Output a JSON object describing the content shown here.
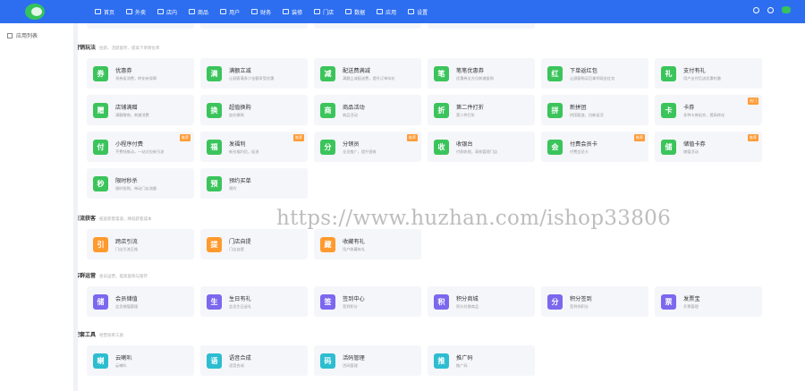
{
  "header": {
    "nav": [
      {
        "label": "首页"
      },
      {
        "label": "外卖"
      },
      {
        "label": "店内"
      },
      {
        "label": "商品"
      },
      {
        "label": "用户"
      },
      {
        "label": "财务"
      },
      {
        "label": "装修"
      },
      {
        "label": "门店"
      },
      {
        "label": "数据"
      },
      {
        "label": "应用"
      },
      {
        "label": "设置"
      }
    ]
  },
  "sidebar": {
    "item": "应用列表"
  },
  "sections": [
    {
      "title": "营销玩法",
      "subtitle": "拉新、活跃留存、提高下单转化率",
      "cards": [
        {
          "name": "优惠券",
          "desc": "领券促消费，转化有保障",
          "icon": "券",
          "color": "#3bc45b"
        },
        {
          "name": "满额立减",
          "desc": "让顾客满多少金额享受优惠",
          "icon": "满",
          "color": "#3bc45b"
        },
        {
          "name": "配送费满减",
          "desc": "满额立减配送费，提升订单均价",
          "icon": "减",
          "color": "#3bc45b"
        },
        {
          "name": "笔笔优惠券",
          "desc": "优惠券全方位刺激复购",
          "icon": "笔",
          "color": "#3bc45b"
        },
        {
          "name": "下单返红包",
          "desc": "让顾客购买后拿到现金红包",
          "icon": "红",
          "color": "#3bc45b"
        },
        {
          "name": "支付有礼",
          "desc": "用户支付后送优惠刺激",
          "icon": "礼",
          "color": "#3bc45b"
        },
        {
          "name": "店铺满赠",
          "desc": "满额赠商，刺激消费",
          "icon": "赠",
          "color": "#3bc45b"
        },
        {
          "name": "超值换购",
          "desc": "加价换购",
          "icon": "换",
          "color": "#3bc45b"
        },
        {
          "name": "商品活动",
          "desc": "商品活动",
          "icon": "商",
          "color": "#3bc45b"
        },
        {
          "name": "第二件打折",
          "desc": "第二件打折",
          "icon": "折",
          "color": "#3bc45b"
        },
        {
          "name": "新拼团",
          "desc": "拼团裂变，拉新促活",
          "icon": "拼",
          "color": "#3bc45b"
        },
        {
          "name": "卡券",
          "desc": "多种卡券组合，提高转化",
          "icon": "卡",
          "color": "#3bc45b",
          "badge": "热门"
        },
        {
          "name": "小程序付费",
          "desc": "不费钱推动，一站式拉新引流",
          "icon": "付",
          "color": "#3bc45b",
          "badge": "推荐"
        },
        {
          "name": "发福利",
          "desc": "新拉福利员，促进",
          "icon": "福",
          "color": "#3bc45b",
          "badge": "推荐"
        },
        {
          "name": "分销员",
          "desc": "全员推广，提升营收",
          "icon": "分",
          "color": "#3bc45b",
          "badge": "推荐"
        },
        {
          "name": "收银台",
          "desc": "付款收银，高效管理门店",
          "icon": "收",
          "color": "#3bc45b"
        },
        {
          "name": "付费会员卡",
          "desc": "付费会员卡",
          "icon": "会",
          "color": "#3bc45b",
          "badge": "推荐"
        },
        {
          "name": "储值卡券",
          "desc": "储值活动",
          "icon": "储",
          "color": "#3bc45b",
          "badge": "推荐"
        },
        {
          "name": "限时秒杀",
          "desc": "限时抢购，带动门店流量",
          "icon": "秒",
          "color": "#3bc45b"
        },
        {
          "name": "预约买单",
          "desc": "预约",
          "icon": "预",
          "color": "#3bc45b"
        }
      ]
    },
    {
      "title": "引流获客",
      "subtitle": "拓宽获客渠道，降低获客成本",
      "cards": [
        {
          "name": "跨店引流",
          "desc": "门店引流互推",
          "icon": "引",
          "color": "#ff9a2e"
        },
        {
          "name": "门店自提",
          "desc": "门店自提",
          "icon": "提",
          "color": "#ff9a2e"
        },
        {
          "name": "收藏有礼",
          "desc": "用户收藏有礼",
          "icon": "藏",
          "color": "#ff9a2e"
        }
      ]
    },
    {
      "title": "客群运营",
      "subtitle": "会员运营，提高复购与留存",
      "cards": [
        {
          "name": "会员储值",
          "desc": "会员储值管理",
          "icon": "储",
          "color": "#7b68ee"
        },
        {
          "name": "生日有礼",
          "desc": "会员生日送礼",
          "icon": "生",
          "color": "#7b68ee"
        },
        {
          "name": "签到中心",
          "desc": "签到积分",
          "icon": "签",
          "color": "#7b68ee"
        },
        {
          "name": "积分商城",
          "desc": "积分兑换商品",
          "icon": "积",
          "color": "#7b68ee"
        },
        {
          "name": "积分签到",
          "desc": "签到领积分",
          "icon": "分",
          "color": "#7b68ee"
        },
        {
          "name": "发票宝",
          "desc": "开票管理",
          "icon": "票",
          "color": "#7b68ee"
        }
      ]
    },
    {
      "title": "配套工具",
      "subtitle": "经营效率工具",
      "cards": [
        {
          "name": "云喇叭",
          "desc": "云喇叭",
          "icon": "喇",
          "color": "#2dbdd1"
        },
        {
          "name": "语音合成",
          "desc": "语音合成",
          "icon": "语",
          "color": "#2dbdd1"
        },
        {
          "name": "活码管理",
          "desc": "活码管理",
          "icon": "码",
          "color": "#2dbdd1"
        },
        {
          "name": "推广码",
          "desc": "推广码",
          "icon": "推",
          "color": "#2dbdd1"
        }
      ]
    }
  ],
  "watermark": "https://www.huzhan.com/ishop33806"
}
